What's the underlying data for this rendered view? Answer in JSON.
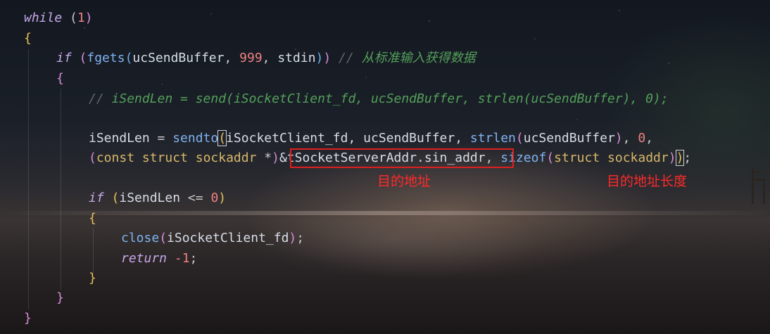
{
  "editor": {
    "theme_colors": {
      "keyword": "#c7a8e8",
      "function": "#7fb2f0",
      "number": "#f08080",
      "type": "#d8b86a",
      "comment": "#54a05a",
      "annotation": "#ff2a2a"
    },
    "code": {
      "l1_kw": "while",
      "l1_rest": " (",
      "l1_num": "1",
      "l1_close": ")",
      "l2": "{",
      "l3_kw": "if",
      "l3_p1": " (",
      "l3_fn": "fgets",
      "l3_p2": "(",
      "l3_arg1": "ucSendBuffer",
      "l3_c1": ", ",
      "l3_num": "999",
      "l3_c2": ", ",
      "l3_arg3": "stdin",
      "l3_p3": ")",
      "l3_p4": ")",
      "l3_cmt_slash": " // ",
      "l3_cmt": "从标准输入获得数据",
      "l4": "{",
      "l5_cmt_slash": "// ",
      "l5_cmt": "iSendLen = send(iSocketClient_fd, ucSendBuffer, strlen(ucSendBuffer), 0);",
      "l7_var": "iSendLen",
      "l7_eq": " = ",
      "l7_fn": "sendto",
      "l7_p1": "(",
      "l7_args": "iSocketClient_fd, ucSendBuffer, ",
      "l7_fn2": "strlen",
      "l7_p2": "(",
      "l7_arg": "ucSendBuffer",
      "l7_p3": ")",
      "l7_tail": ", ",
      "l7_num": "0",
      "l7_end": ",",
      "l8_p1": "(",
      "l8_kw1": "const",
      "l8_sp1": " ",
      "l8_kw2": "struct",
      "l8_sp2": " ",
      "l8_type": "sockaddr",
      "l8_star": " *",
      "l8_p2": ")",
      "l8_addr": "&tSocketServerAddr.sin_addr",
      "l8_c": ", ",
      "l8_fn": "sizeof",
      "l8_p3": "(",
      "l8_kw3": "struct",
      "l8_sp3": " ",
      "l8_type2": "sockaddr",
      "l8_p4": ")",
      "l8_p5": ")",
      "l8_semi": ";",
      "l10_kw": "if",
      "l10_p1": " (",
      "l10_var": "iSendLen",
      "l10_op": " <= ",
      "l10_num": "0",
      "l10_p2": ")",
      "l11": "{",
      "l12_fn": "close",
      "l12_p1": "(",
      "l12_arg": "iSocketClient_fd",
      "l12_p2": ")",
      "l12_semi": ";",
      "l13_kw": "return",
      "l13_num": " -1",
      "l13_semi": ";",
      "l14": "}",
      "l15": "}",
      "l16": "}"
    },
    "annotations": {
      "dest_addr": "目的地址",
      "dest_addr_len": "目的地址长度"
    }
  }
}
